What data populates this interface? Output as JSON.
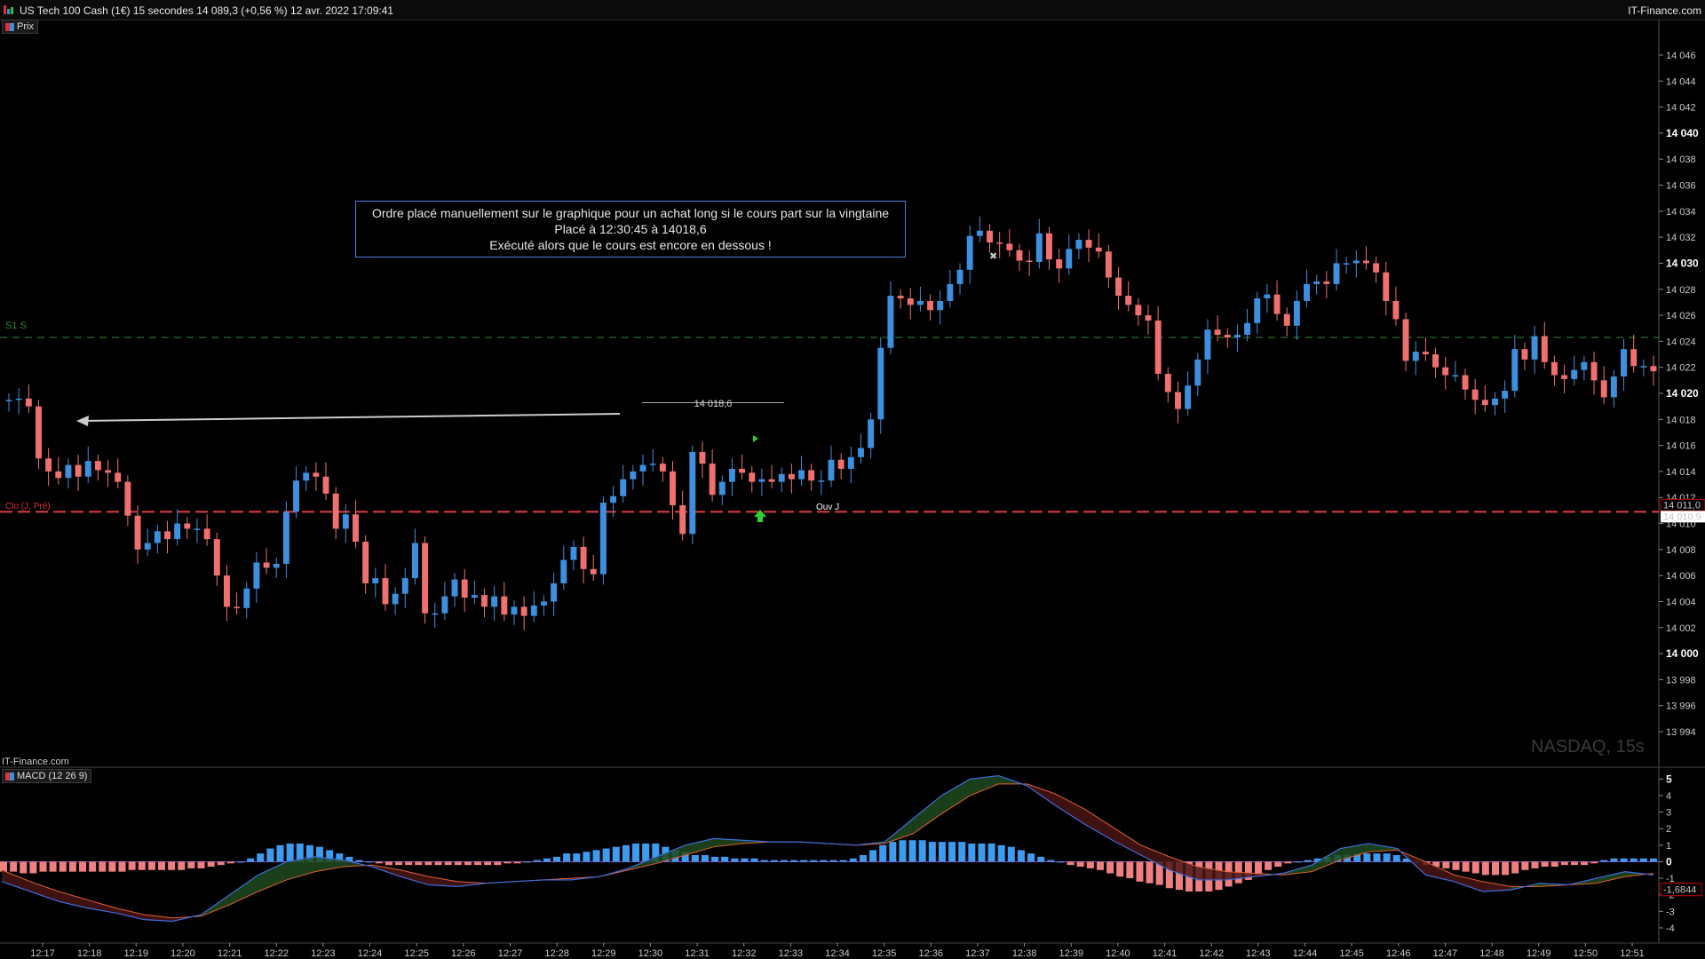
{
  "header": {
    "title": "US Tech 100 Cash (1€) 15 secondes 14 089,3 (+0,56 %) 12 avr. 2022 17:09:41",
    "brand": "IT-Finance.com"
  },
  "price_panel": {
    "tag": "Prix",
    "watermark": "NASDAQ, 15s",
    "bottom_brand": "IT-Finance.com",
    "s1_label": "S1 S",
    "clo_label": "Clo (J, Pré)",
    "ouv_label": "Ouv J",
    "order_price_label": "14 018,6",
    "clo_axis_tag": "14 011,0",
    "last_axis_tag": "14 010,9",
    "annotation": {
      "line1": "Ordre placé manuellement sur le graphique pour un achat long si le cours part sur la vingtaine",
      "line2": "Placé à 12:30:45 à 14018,6",
      "line3": "Exécuté alors que le cours est encore en dessous !"
    }
  },
  "macd_panel": {
    "tag": "MACD (12 26 9)",
    "value_tag": "-1,6844"
  },
  "colors": {
    "up": "#3d8fe0",
    "down": "#f07070",
    "s1_line": "#2e8b2e",
    "clo_line": "#e04040",
    "macd_line": "#3a6ee0",
    "signal_line": "#e06030"
  },
  "chart_data": [
    {
      "type": "candlestick",
      "title": "US Tech 100 Cash (1€) 15 secondes",
      "y_ticks": [
        "14 046",
        "14 044",
        "14 042",
        "14 040",
        "14 038",
        "14 036",
        "14 034",
        "14 032",
        "14 030",
        "14 028",
        "14 026",
        "14 024",
        "14 022",
        "14 020",
        "14 018",
        "14 016",
        "14 014",
        "14 012",
        "14 010",
        "14 008",
        "14 006",
        "14 004",
        "14 002",
        "14 000",
        "13 998",
        "13 996",
        "13 994"
      ],
      "y_tick_values": [
        14046,
        14044,
        14042,
        14040,
        14038,
        14036,
        14034,
        14032,
        14030,
        14028,
        14026,
        14024,
        14022,
        14020,
        14018,
        14016,
        14014,
        14012,
        14010,
        14008,
        14006,
        14004,
        14002,
        14000,
        13998,
        13996,
        13994
      ],
      "y_bold": [
        14040,
        14030,
        14020,
        14000
      ],
      "ylim": [
        13992.5,
        14047.5
      ],
      "x_ticks": [
        "12:17",
        "12:18",
        "12:19",
        "12:20",
        "12:21",
        "12:22",
        "12:23",
        "12:24",
        "12:25",
        "12:26",
        "12:27",
        "12:28",
        "12:29",
        "12:30",
        "12:31",
        "12:32",
        "12:33",
        "12:34",
        "12:35",
        "12:36",
        "12:37",
        "12:38",
        "12:39",
        "12:40",
        "12:41",
        "12:42",
        "12:43",
        "12:44",
        "12:45",
        "12:46",
        "12:47",
        "12:48",
        "12:49",
        "12:50",
        "12:51"
      ],
      "levels": {
        "s1": 14024.3,
        "clo_prev": 14010.9,
        "order": 14018.6
      },
      "closes": [
        14019.5,
        14019.6,
        14019.0,
        14015,
        14014,
        14013.5,
        14014.5,
        14013.6,
        14014.8,
        14014.1,
        14013.9,
        14013.2,
        14010.6,
        14008,
        14008.5,
        14009.4,
        14008.8,
        14010,
        14009.6,
        14009.6,
        14008.8,
        14006,
        14003.6,
        14003.5,
        14005,
        14007,
        14006.6,
        14006.9,
        14010.9,
        14013.3,
        14013.9,
        14013.6,
        14012.3,
        14009.6,
        14010.7,
        14008.6,
        14005.4,
        14005.8,
        14003.8,
        14004.6,
        14005.8,
        14008.5,
        14003.1,
        14003.1,
        14004.4,
        14005.7,
        14004.3,
        14004.5,
        14003.6,
        14004.4,
        14003,
        14003.6,
        14002.9,
        14003.7,
        14004,
        14005.4,
        14007.2,
        14008.2,
        14006.5,
        14006.1,
        14011.6,
        14012.1,
        14013.4,
        14014,
        14014.5,
        14014.6,
        14014,
        14011.4,
        14009.2,
        14015.5,
        14014.6,
        14012.2,
        14013.2,
        14014.2,
        14013.9,
        14013.2,
        14013.4,
        14013.2,
        14013.8,
        14013.4,
        14014.1,
        14013.3,
        14013.3,
        14014.9,
        14014.2,
        14015.1,
        14015.8,
        14018,
        14023.5,
        14027.5,
        14027.3,
        14026.8,
        14027.1,
        14026.4,
        14027.1,
        14028.4,
        14029.5,
        14032.1,
        14032.5,
        14031.6,
        14031.5,
        14031,
        14030.2,
        14030.1,
        14032.3,
        14030.3,
        14029.6,
        14031.1,
        14031.8,
        14031.2,
        14030.9,
        14028.9,
        14027.5,
        14026.8,
        14026,
        14025.6,
        14021.5,
        14020.1,
        14018.8,
        14020.6,
        14022.6,
        14024.9,
        14024.5,
        14024.3,
        14024.5,
        14025.4,
        14027.3,
        14027.6,
        14026.1,
        14025.2,
        14027.1,
        14028.4,
        14028.6,
        14028.4,
        14030,
        14030,
        14030.2,
        14030,
        14029.3,
        14027.1,
        14025.7,
        14022.5,
        14023.2,
        14023,
        14022,
        14021.4,
        14021.4,
        14020.3,
        14019.5,
        14019.1,
        14019.6,
        14020.2,
        14023.4,
        14022.6,
        14024.4,
        14022.4,
        14021.4,
        14021.1,
        14021.8,
        14022.4,
        14021,
        14019.7,
        14021.3,
        14023.4,
        14022.1,
        14022.1,
        14021.7
      ],
      "opens": [
        14019.4,
        14019.5,
        14019.6,
        14019.0,
        14015,
        14014,
        14013.5,
        14014.5,
        14013.6,
        14014.8,
        14014.1,
        14013.9,
        14013.2,
        14010.6,
        14008,
        14008.5,
        14009.4,
        14008.8,
        14010,
        14009.6,
        14009.6,
        14008.8,
        14006,
        14003.6,
        14003.5,
        14005,
        14007,
        14006.6,
        14006.9,
        14010.9,
        14013.3,
        14013.9,
        14013.6,
        14012.3,
        14009.6,
        14010.7,
        14008.6,
        14005.4,
        14005.8,
        14003.8,
        14004.6,
        14005.8,
        14008.5,
        14003.1,
        14003.1,
        14004.4,
        14005.7,
        14004.3,
        14004.5,
        14003.6,
        14004.4,
        14003,
        14003.6,
        14002.9,
        14003.7,
        14004,
        14005.4,
        14007.2,
        14008.2,
        14006.5,
        14006.1,
        14011.6,
        14012.1,
        14013.4,
        14014,
        14014.5,
        14014.6,
        14014,
        14011.4,
        14009.2,
        14015.5,
        14014.6,
        14012.2,
        14013.2,
        14014.2,
        14013.9,
        14013.2,
        14013.4,
        14013.2,
        14013.8,
        14013.4,
        14014.1,
        14013.3,
        14013.3,
        14014.9,
        14014.2,
        14015.1,
        14015.8,
        14018,
        14023.5,
        14027.5,
        14027.3,
        14026.8,
        14027.1,
        14026.4,
        14027.1,
        14028.4,
        14029.5,
        14032.1,
        14032.5,
        14031.6,
        14031.5,
        14031,
        14030.2,
        14030.1,
        14032.3,
        14030.3,
        14029.6,
        14031.1,
        14031.8,
        14031.2,
        14030.9,
        14028.9,
        14027.5,
        14026.8,
        14026,
        14025.6,
        14021.5,
        14020.1,
        14018.8,
        14020.6,
        14022.6,
        14024.9,
        14024.5,
        14024.3,
        14024.5,
        14025.4,
        14027.3,
        14027.6,
        14026.1,
        14025.2,
        14027.1,
        14028.4,
        14028.6,
        14028.4,
        14030,
        14030,
        14030.2,
        14030,
        14029.3,
        14027.1,
        14025.7,
        14022.5,
        14023.2,
        14023,
        14022,
        14021.4,
        14021.4,
        14020.3,
        14019.5,
        14019.1,
        14019.6,
        14020.2,
        14023.4,
        14022.6,
        14024.4,
        14022.4,
        14021.4,
        14021.1,
        14021.8,
        14022.4,
        14021,
        14019.7,
        14021.3,
        14023.4,
        14022.1,
        14022.1
      ]
    },
    {
      "type": "line",
      "title": "MACD (12 26 9)",
      "y_ticks": [
        "5",
        "4",
        "3",
        "2",
        "1",
        "0",
        "-1",
        "-2",
        "-3",
        "-4"
      ],
      "y_tick_values": [
        5,
        4,
        3,
        2,
        1,
        0,
        -1,
        -2,
        -3,
        -4
      ],
      "ylim": [
        -4.7,
        5.5
      ],
      "macd": [
        -1.2,
        -1.8,
        -2.4,
        -2.8,
        -3.1,
        -3.5,
        -3.6,
        -3.2,
        -2.0,
        -0.8,
        0.0,
        0.3,
        0.1,
        -0.3,
        -0.9,
        -1.4,
        -1.5,
        -1.3,
        -1.2,
        -1.1,
        -1.1,
        -0.9,
        -0.4,
        0.3,
        1.0,
        1.4,
        1.3,
        1.2,
        1.2,
        1.1,
        1.0,
        1.2,
        2.6,
        4.0,
        5.0,
        5.2,
        4.6,
        3.4,
        2.3,
        1.3,
        0.4,
        -0.5,
        -1.1,
        -1.1,
        -0.9,
        -0.7,
        -0.2,
        0.8,
        1.1,
        0.8,
        -0.8,
        -1.2,
        -1.8,
        -1.7,
        -1.3,
        -1.4,
        -1.0,
        -0.6,
        -0.8
      ],
      "signal": [
        -0.5,
        -1.2,
        -1.8,
        -2.3,
        -2.8,
        -3.2,
        -3.4,
        -3.3,
        -2.6,
        -1.8,
        -1.1,
        -0.6,
        -0.3,
        -0.2,
        -0.5,
        -0.9,
        -1.2,
        -1.3,
        -1.2,
        -1.1,
        -1.0,
        -0.9,
        -0.5,
        -0.1,
        0.4,
        0.9,
        1.1,
        1.2,
        1.2,
        1.1,
        1.0,
        1.1,
        1.7,
        2.9,
        4.0,
        4.7,
        4.7,
        4.1,
        3.2,
        2.1,
        1.0,
        0.3,
        -0.3,
        -0.6,
        -0.7,
        -0.8,
        -0.6,
        0.1,
        0.6,
        0.7,
        0.0,
        -0.8,
        -1.2,
        -1.5,
        -1.5,
        -1.4,
        -1.3,
        -0.9,
        -0.7
      ],
      "histogram": [
        -0.6,
        -0.6,
        -0.7,
        -0.7,
        -0.6,
        -0.6,
        -0.6,
        -0.6,
        -0.6,
        -0.6,
        -0.6,
        -0.6,
        -0.6,
        -0.5,
        -0.5,
        -0.5,
        -0.5,
        -0.5,
        -0.5,
        -0.4,
        -0.4,
        -0.3,
        -0.2,
        -0.1,
        0.0,
        0.2,
        0.5,
        0.8,
        1.0,
        1.1,
        1.1,
        1.0,
        0.9,
        0.7,
        0.5,
        0.3,
        0.1,
        0.0,
        -0.1,
        -0.2,
        -0.2,
        -0.2,
        -0.2,
        -0.2,
        -0.2,
        -0.2,
        -0.2,
        -0.2,
        -0.2,
        -0.2,
        -0.2,
        -0.1,
        -0.1,
        0.0,
        0.1,
        0.2,
        0.3,
        0.5,
        0.5,
        0.6,
        0.7,
        0.8,
        0.9,
        1.0,
        1.1,
        1.1,
        1.1,
        0.9,
        0.7,
        0.6,
        0.4,
        0.4,
        0.3,
        0.3,
        0.2,
        0.2,
        0.2,
        0.1,
        0.1,
        0.1,
        0.1,
        0.1,
        0.1,
        0.1,
        0.1,
        0.1,
        0.2,
        0.4,
        0.7,
        1.0,
        1.2,
        1.3,
        1.3,
        1.3,
        1.2,
        1.2,
        1.2,
        1.2,
        1.1,
        1.1,
        1.1,
        1.0,
        0.9,
        0.7,
        0.5,
        0.3,
        0.1,
        0.0,
        -0.2,
        -0.3,
        -0.4,
        -0.5,
        -0.7,
        -0.9,
        -1.0,
        -1.2,
        -1.3,
        -1.4,
        -1.6,
        -1.7,
        -1.8,
        -1.8,
        -1.8,
        -1.7,
        -1.5,
        -1.3,
        -1.1,
        -0.8,
        -0.5,
        -0.3,
        -0.1,
        0.0,
        0.1,
        0.2,
        0.3,
        0.4,
        0.4,
        0.5,
        0.5,
        0.5,
        0.5,
        0.4,
        0.2,
        0.0,
        -0.2,
        -0.3,
        -0.4,
        -0.5,
        -0.6,
        -0.7,
        -0.8,
        -0.8,
        -0.8,
        -0.7,
        -0.5,
        -0.4,
        -0.3,
        -0.3,
        -0.2,
        -0.2,
        -0.2,
        -0.1,
        0.1,
        0.2,
        0.2,
        0.2,
        0.2,
        0.2
      ]
    }
  ]
}
